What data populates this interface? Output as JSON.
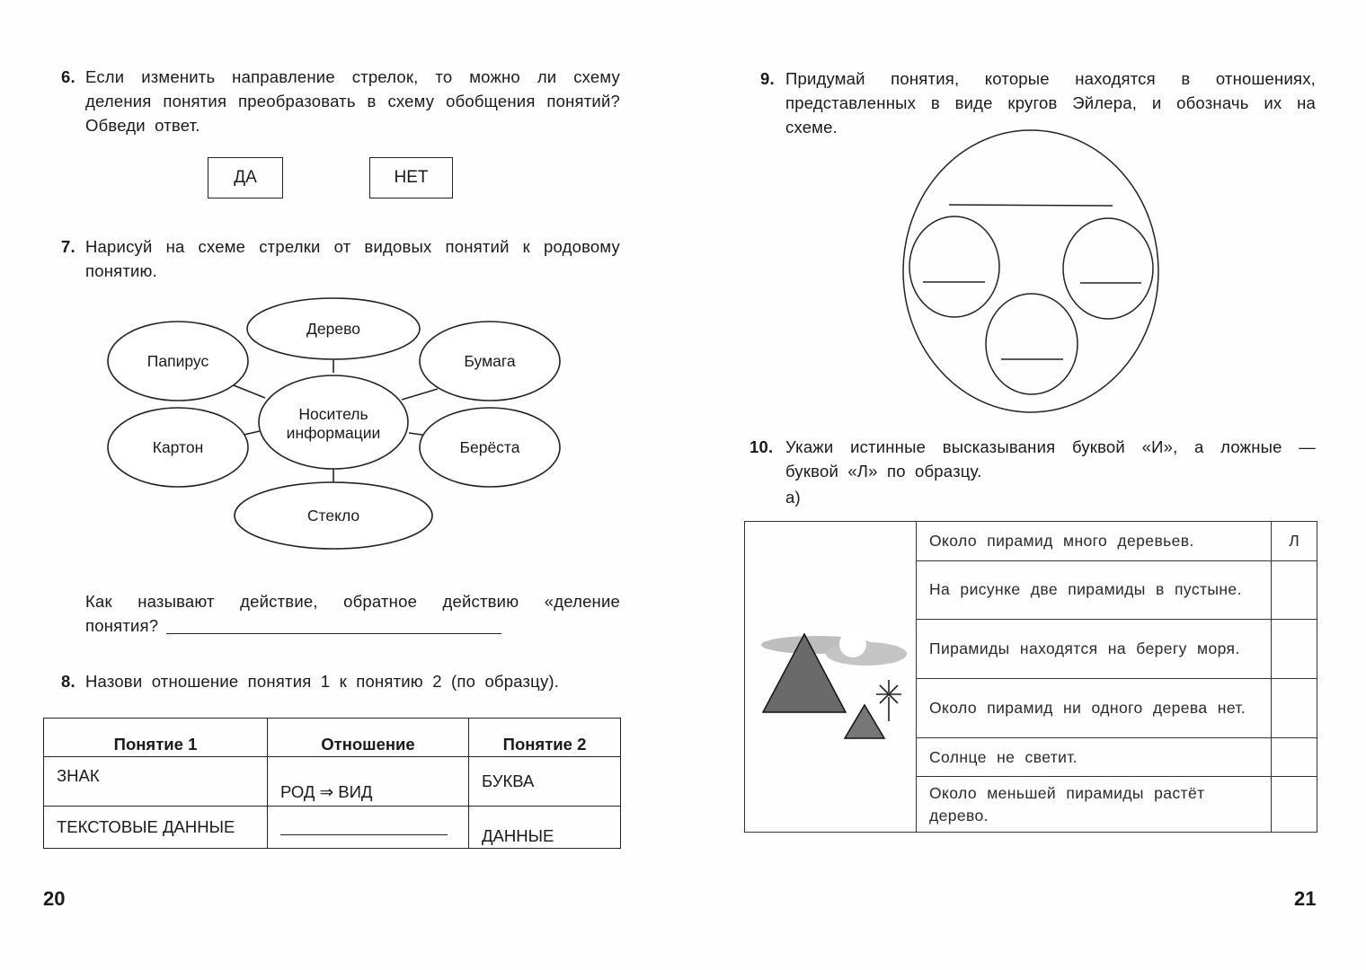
{
  "pages": {
    "left_number": "20",
    "right_number": "21"
  },
  "q6": {
    "number": "6.",
    "text": "Если изменить направление стрелок, то можно ли схему деления понятия преобразовать в схему обобщения понятий? Обведи ответ.",
    "options": [
      "ДА",
      "НЕТ"
    ]
  },
  "q7": {
    "number": "7.",
    "text": "Нарисуй на схеме стрелки от видовых понятий к родовому понятию.",
    "center_line1": "Носитель",
    "center_line2": "информации",
    "nodes": {
      "top": "Дерево",
      "top_left": "Папирус",
      "top_right": "Бумага",
      "bottom_left": "Картон",
      "bottom_right": "Берёста",
      "bottom": "Стекло"
    },
    "followup": "Как называют действие, обратное действию «деление понятия?"
  },
  "q8": {
    "number": "8.",
    "text": "Назови отношение понятия 1 к понятию 2 (по образцу).",
    "headers": [
      "Понятие 1",
      "Отношение",
      "Понятие 2"
    ],
    "rows": [
      [
        "ЗНАК",
        "РОД ⇒ ВИД",
        "БУКВА"
      ],
      [
        "ТЕКСТОВЫЕ ДАННЫЕ",
        "",
        "ДАННЫЕ"
      ]
    ]
  },
  "q9": {
    "number": "9.",
    "text": "Придумай понятия, которые находятся в отношениях, представленных в виде кругов Эйлера, и обозначь их на схеме."
  },
  "q10": {
    "number": "10.",
    "text": "Укажи истинные высказывания буквой «И», а ложные — буквой «Л» по образцу.",
    "subpart": "а)",
    "statements": [
      {
        "text": "Около пирамид много деревьев.",
        "answer": "Л"
      },
      {
        "text": "На рисунке две пирамиды в пустыне.",
        "answer": ""
      },
      {
        "text": "Пирамиды находятся на берегу моря.",
        "answer": ""
      },
      {
        "text": "Около пирамид ни одного дерева нет.",
        "answer": ""
      },
      {
        "text": "Солнце не светит.",
        "answer": ""
      },
      {
        "text": "Около меньшей пирамиды растёт дерево.",
        "answer": ""
      }
    ]
  }
}
